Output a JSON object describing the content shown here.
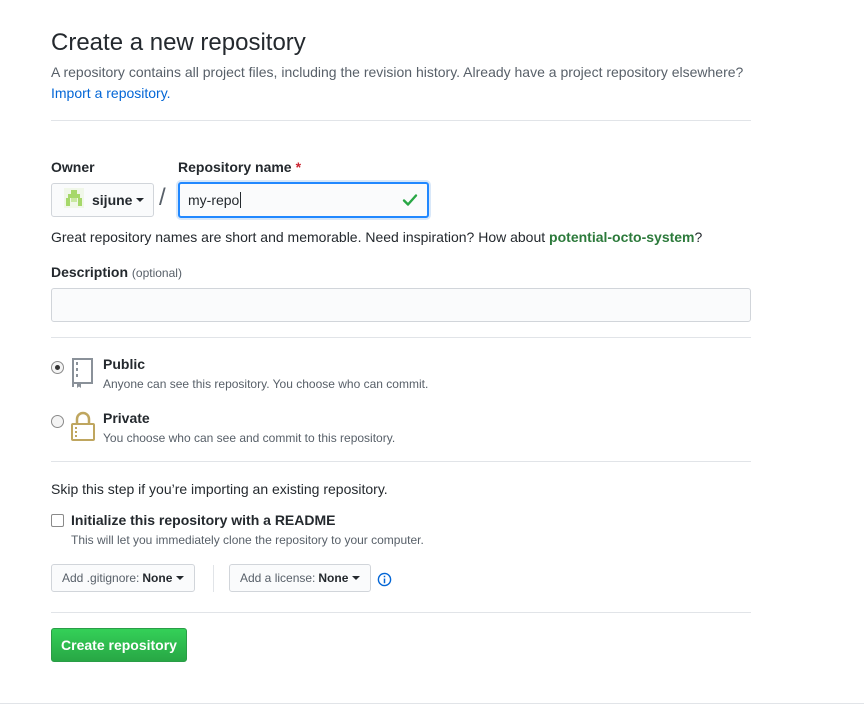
{
  "header": {
    "title": "Create a new repository",
    "subtitle": "A repository contains all project files, including the revision history. Already have a project repository elsewhere?",
    "import_link": "Import a repository."
  },
  "owner": {
    "label": "Owner",
    "value": "sijune"
  },
  "separator": "/",
  "repo_name": {
    "label": "Repository name",
    "required_mark": "*",
    "value": "my-repo"
  },
  "hint": {
    "text": "Great repository names are short and memorable. Need inspiration? How about ",
    "suggestion": "potential-octo-system",
    "end": "?"
  },
  "description": {
    "label": "Description",
    "optional": "(optional)",
    "value": ""
  },
  "visibility": {
    "selected": "Public",
    "options": [
      {
        "title": "Public",
        "note": "Anyone can see this repository. You choose who can commit.",
        "icon": "repo-book-icon"
      },
      {
        "title": "Private",
        "note": "You choose who can see and commit to this repository.",
        "icon": "lock-icon"
      }
    ]
  },
  "init": {
    "skip_text": "Skip this step if you’re importing an existing repository.",
    "readme_label": "Initialize this repository with a README",
    "readme_note": "This will let you immediately clone the repository to your computer.",
    "readme_checked": false
  },
  "gitignore": {
    "prefix": "Add .gitignore:",
    "value": "None"
  },
  "license": {
    "prefix": "Add a license:",
    "value": "None"
  },
  "submit_label": "Create repository",
  "colors": {
    "link": "#0366d6",
    "success": "#28a745",
    "focus": "#2188ff",
    "required": "#cb2431"
  }
}
